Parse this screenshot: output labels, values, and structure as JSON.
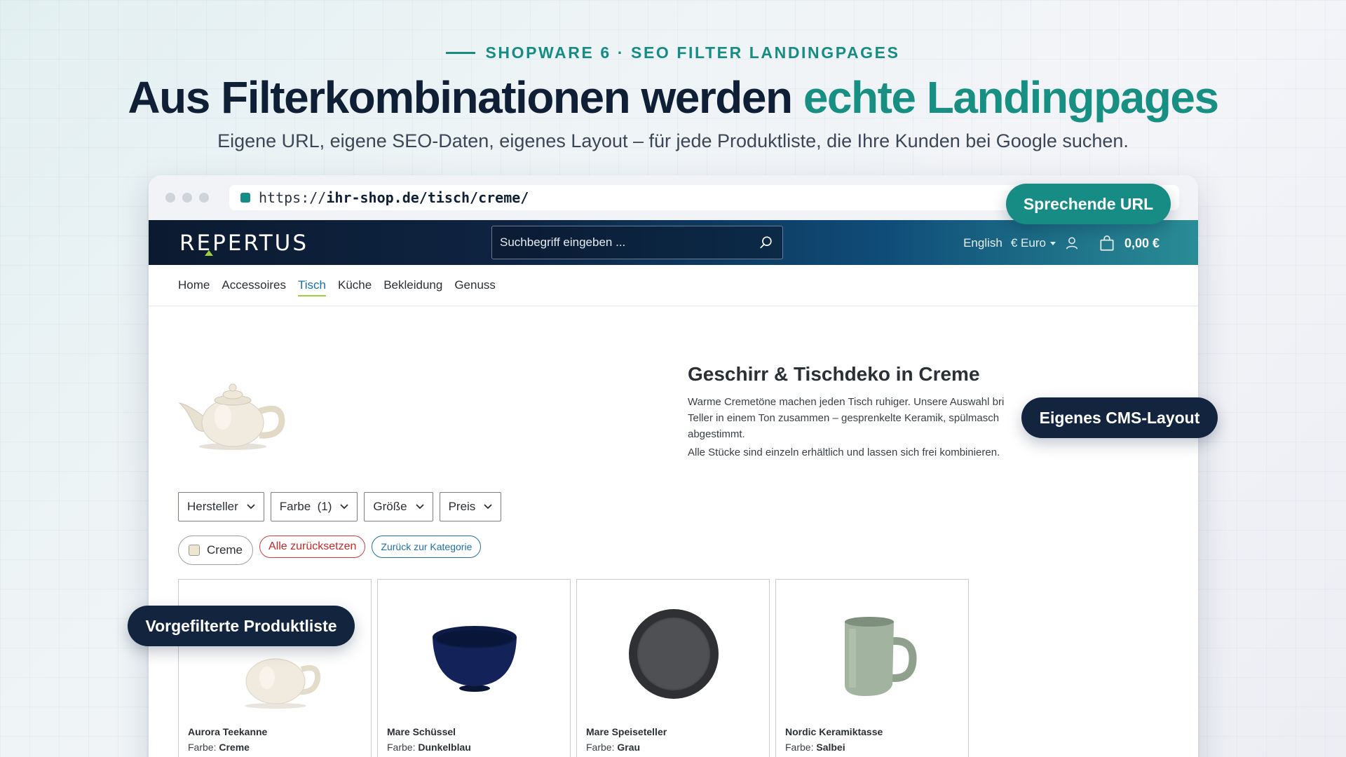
{
  "hero": {
    "eyebrow": "SHOPWARE 6 · SEO FILTER LANDINGPAGES",
    "headline_main": "Aus Filterkombinationen werden ",
    "headline_accent": "echte Landingpages",
    "subline": "Eigene URL, eigene SEO-Daten, eigenes Layout – für jede Produktliste, die Ihre Kunden bei Google suchen."
  },
  "browser": {
    "url_prefix": "https://",
    "url_path": "ihr-shop.de/tisch/creme/"
  },
  "shop": {
    "logo": "REPERTUS",
    "search_placeholder": "Suchbegriff eingeben ...",
    "language": "English",
    "currency": "€ Euro",
    "cart_total": "0,00 €",
    "nav": [
      "Home",
      "Accessoires",
      "Tisch",
      "Küche",
      "Bekleidung",
      "Genuss"
    ],
    "active_nav": "Tisch"
  },
  "cms": {
    "title": "Geschirr & Tischdeko in Creme",
    "text_line1": "Warme Cremetöne machen jeden Tisch ruhiger. Unsere Auswahl bri",
    "text_line2": "Teller in einem Ton zusammen – gesprenkelte Keramik, spülmasch",
    "text_line3": "abgestimmt.",
    "text_line4": "Alle Stücke sind einzeln erhältlich und lassen sich frei kombinieren."
  },
  "filters": {
    "manufacturer": "Hersteller",
    "color": "Farbe  (1)",
    "size": "Größe",
    "price": "Preis"
  },
  "active_filters": {
    "creme": "Creme",
    "reset": "Alle zurücksetzen",
    "back": "Zurück zur Kategorie"
  },
  "products": [
    {
      "name": "Aurora Teekanne",
      "attr_label": "Farbe: ",
      "attr_value": "Creme"
    },
    {
      "name": "Mare Schüssel",
      "attr_label": "Farbe: ",
      "attr_value": "Dunkelblau"
    },
    {
      "name": "Mare Speiseteller",
      "attr_label": "Farbe: ",
      "attr_value": "Grau"
    },
    {
      "name": "Nordic Keramiktasse",
      "attr_label": "Farbe: ",
      "attr_value": "Salbei"
    }
  ],
  "badges": {
    "url": "Sprechende URL",
    "cms": "Eigenes CMS-Layout",
    "list": "Vorgefilterte Produktliste"
  },
  "colors": {
    "accent": "#178f83",
    "navy": "#13243f",
    "creme": "#efe6d2",
    "dark_blue": "#0f1d4a",
    "grey": "#3c3d40",
    "sage": "#9aac98"
  }
}
